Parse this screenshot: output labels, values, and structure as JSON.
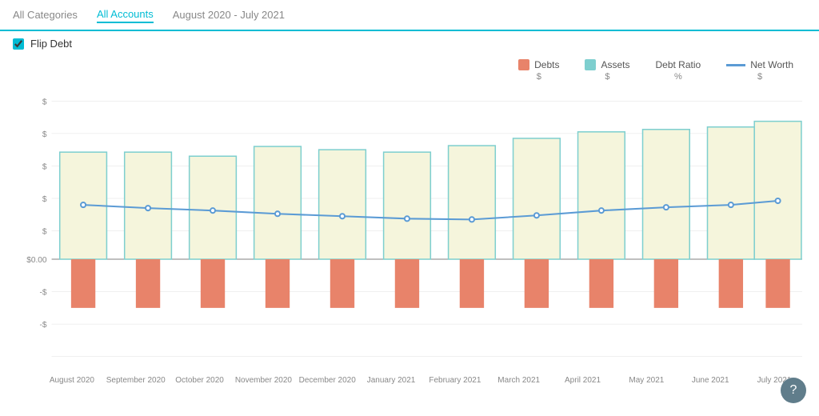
{
  "topbar": {
    "items": [
      {
        "label": "All Categories",
        "active": false
      },
      {
        "label": "All Accounts",
        "active": true
      },
      {
        "label": "August 2020 - July 2021",
        "active": false
      }
    ]
  },
  "flipDebt": {
    "label": "Flip Debt",
    "checked": true
  },
  "legend": {
    "items": [
      {
        "label": "Debts",
        "unit": "$",
        "type": "box",
        "color": "#e8836a"
      },
      {
        "label": "Assets",
        "unit": "$",
        "type": "box",
        "color": "#7ecfcf"
      },
      {
        "label": "Debt Ratio",
        "unit": "%",
        "type": "none"
      },
      {
        "label": "Net Worth",
        "unit": "$",
        "type": "line"
      }
    ]
  },
  "chart": {
    "months": [
      "August 2020",
      "September 2020",
      "October 2020",
      "November 2020",
      "December 2020",
      "January 2021",
      "February 2021",
      "March 2021",
      "April 2021",
      "May 2021",
      "June 2021",
      "July 2021"
    ],
    "yLabels": [
      "$",
      "$",
      "$",
      "$",
      "$",
      "$0.00",
      "-$",
      "-$"
    ],
    "assetHeights": [
      0.52,
      0.52,
      0.5,
      0.54,
      0.53,
      0.52,
      0.55,
      0.58,
      0.61,
      0.62,
      0.62,
      0.66
    ],
    "debtHeights": [
      0.13,
      0.13,
      0.13,
      0.13,
      0.13,
      0.13,
      0.13,
      0.13,
      0.13,
      0.13,
      0.13,
      0.13
    ],
    "netWorthLine": [
      0.375,
      0.37,
      0.368,
      0.355,
      0.348,
      0.345,
      0.34,
      0.325,
      0.31,
      0.3,
      0.29,
      0.27
    ]
  },
  "help": {
    "label": "?"
  }
}
